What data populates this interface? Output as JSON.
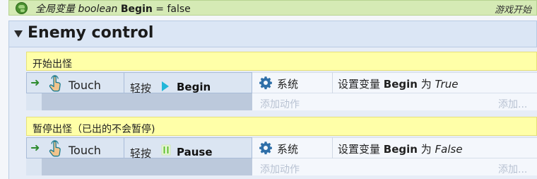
{
  "global_var": {
    "prefix": "全局变量",
    "type": "boolean",
    "name": "Begin",
    "assign": "= false",
    "label": "游戏开始"
  },
  "group": {
    "title": "Enemy control"
  },
  "events": [
    {
      "title": "开始出怪",
      "condition": {
        "object": "Touch",
        "text": "轻按",
        "animation": "Begin",
        "icon": "play-icon"
      },
      "action": {
        "object": "系统",
        "prefix": "设置变量",
        "var": "Begin",
        "mid": "为",
        "value": "True"
      },
      "add_action": "添加动作",
      "add_more": "添加..."
    },
    {
      "title": "暂停出怪（已出的不会暂停)",
      "condition": {
        "object": "Touch",
        "text": "轻按",
        "animation": "Pause",
        "icon": "pause-icon"
      },
      "action": {
        "object": "系统",
        "prefix": "设置变量",
        "var": "Begin",
        "mid": "为",
        "value": "False"
      },
      "add_action": "添加动作",
      "add_more": "添加..."
    }
  ],
  "colors": {
    "global_bg": "#d5eab5",
    "group_bg": "#dbe6f5",
    "event_header_bg": "#ffffa8",
    "condition_bg": "#dbe5f2",
    "action_bg": "#f4f7fc",
    "play_accent": "#21b6d9"
  }
}
